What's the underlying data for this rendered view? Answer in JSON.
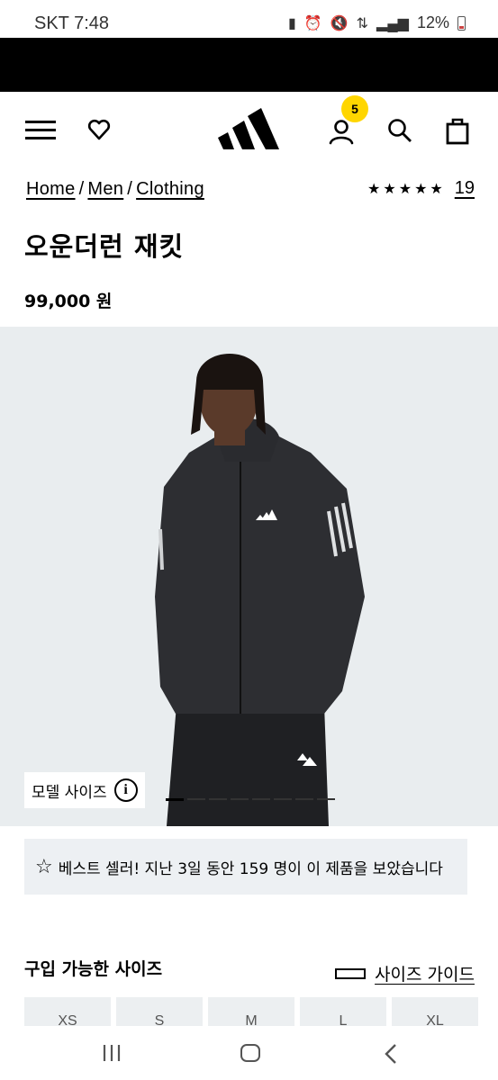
{
  "status_bar": {
    "time": "SKT 7:48",
    "battery": "12%",
    "icons": [
      "sim-icon",
      "alarm-icon",
      "mute-icon",
      "5g-icon",
      "signal-icon",
      "battery-icon"
    ]
  },
  "header": {
    "cart_count": "5",
    "icons": [
      "menu-icon",
      "heart-icon",
      "adidas-logo",
      "account-icon",
      "search-icon",
      "bag-icon"
    ]
  },
  "breadcrumb": {
    "items": [
      "Home",
      "Men",
      "Clothing"
    ],
    "separator": "/"
  },
  "rating": {
    "stars": "★★★★★",
    "review_count": "19"
  },
  "product": {
    "title": "오운더런 재킷",
    "price": "99,000 원",
    "model_size_label": "모델 사이즈",
    "carousel_total": 8,
    "carousel_active": 1
  },
  "bestseller": {
    "text": "베스트 셀러!  지난 3일 동안 159 명이 이 제품을 보았습니다"
  },
  "sizes": {
    "heading": "구입 가능한 사이즈",
    "guide_label": "사이즈 가이드",
    "options": [
      "XS",
      "S",
      "M",
      "L",
      "XL"
    ]
  },
  "colors": {
    "badge": "#ffd600",
    "image_bg": "#e9edef",
    "banner_bg": "#edf0f3"
  }
}
